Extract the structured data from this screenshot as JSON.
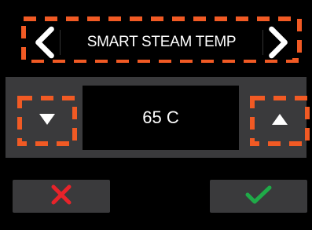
{
  "header": {
    "title": "SMART STEAM TEMP"
  },
  "panel": {
    "value": "65 C"
  },
  "colors": {
    "highlight_dash": "#f15a24",
    "panel_bg": "#3a3a3c",
    "cancel_icon": "#e8232a",
    "confirm_icon": "#1faa48"
  },
  "icons": {
    "prev": "chevron-left-icon",
    "next": "chevron-right-icon",
    "down": "triangle-down-icon",
    "up": "triangle-up-icon",
    "cancel": "close-icon",
    "confirm": "check-icon"
  }
}
